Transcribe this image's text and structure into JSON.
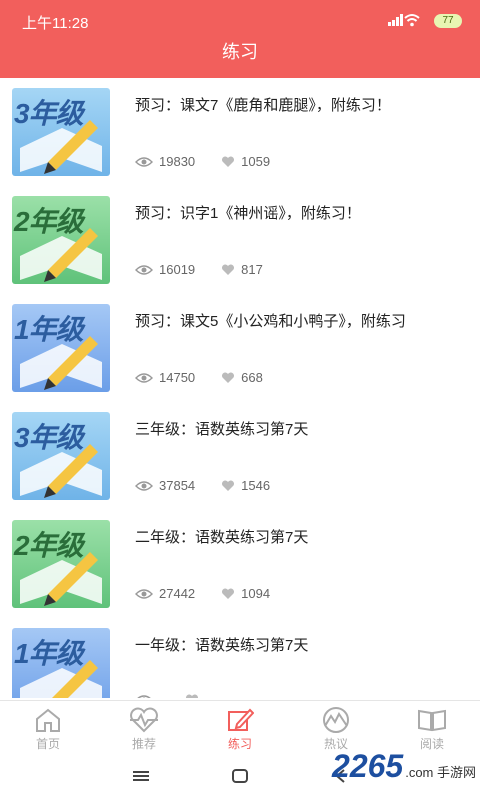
{
  "status_bar": {
    "time": "上午11:28",
    "battery": "77"
  },
  "header": {
    "title": "练习"
  },
  "items": [
    {
      "grade": "3年级",
      "title": "预习：课文7《鹿角和鹿腿》，附练习！",
      "views": "19830",
      "likes": "1059"
    },
    {
      "grade": "2年级",
      "title": "预习：识字1《神州谣》，附练习！",
      "views": "16019",
      "likes": "817"
    },
    {
      "grade": "1年级",
      "title": "预习：课文5《小公鸡和小鸭子》，附练习",
      "views": "14750",
      "likes": "668"
    },
    {
      "grade": "3年级",
      "title": "三年级：语数英练习第7天",
      "views": "37854",
      "likes": "1546"
    },
    {
      "grade": "2年级",
      "title": "二年级：语数英练习第7天",
      "views": "27442",
      "likes": "1094"
    },
    {
      "grade": "1年级",
      "title": "一年级：语数英练习第7天",
      "views": "",
      "likes": ""
    }
  ],
  "tabs": [
    {
      "label": "首页",
      "icon": "home-icon"
    },
    {
      "label": "推荐",
      "icon": "heart-pulse-icon"
    },
    {
      "label": "练习",
      "icon": "edit-icon"
    },
    {
      "label": "热议",
      "icon": "mountain-icon"
    },
    {
      "label": "阅读",
      "icon": "book-icon"
    }
  ],
  "active_tab": 2,
  "colors": {
    "accent": "#f25f5c",
    "tab_inactive": "#aaaaaa"
  },
  "watermark": {
    "brand": "2265",
    "site": ".com 手游网"
  }
}
